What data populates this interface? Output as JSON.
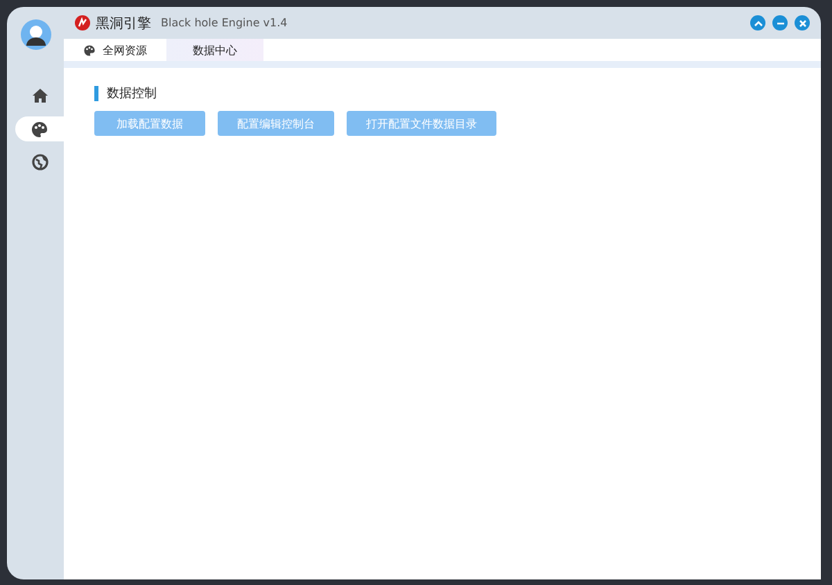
{
  "window": {
    "app_name": "黑洞引擎",
    "subtitle": "Black hole Engine v1.4",
    "controls": [
      {
        "kind": "collapse"
      },
      {
        "kind": "minimize"
      },
      {
        "kind": "close"
      }
    ]
  },
  "sidebar": {
    "items": [
      {
        "kind": "home",
        "selected": false
      },
      {
        "kind": "palette",
        "selected": true
      },
      {
        "kind": "globe",
        "selected": false
      }
    ]
  },
  "tabs": [
    {
      "label": "全网资源",
      "icon": true,
      "selected": false
    },
    {
      "label": "数据中心",
      "icon": false,
      "selected": true
    }
  ],
  "section": {
    "title": "数据控制"
  },
  "buttons": [
    "加载配置数据",
    "配置编辑控制台",
    "打开配置文件数据目录"
  ]
}
